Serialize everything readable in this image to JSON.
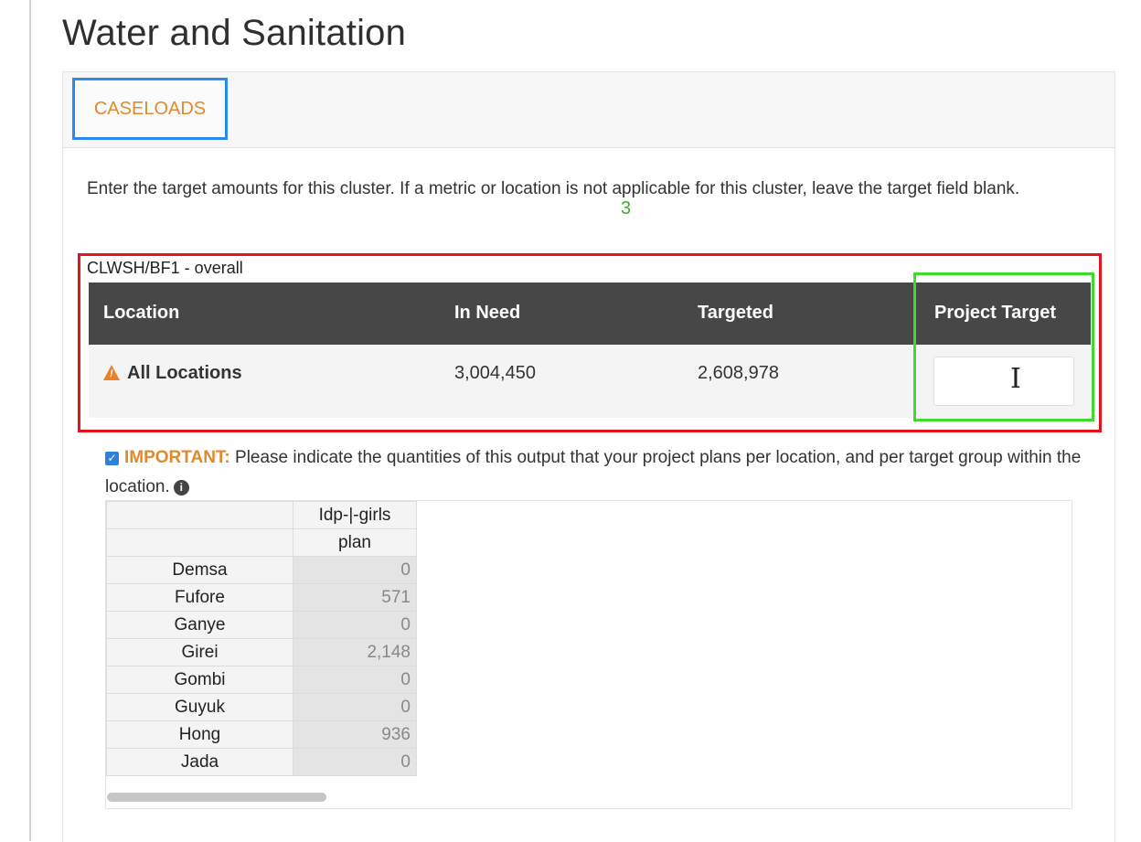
{
  "page": {
    "title": "Water and Sanitation"
  },
  "tabs": [
    {
      "label": "CASELOADS",
      "active": true
    }
  ],
  "instructions": "Enter the target amounts for this cluster. If a metric or location is not applicable for this cluster, leave the target field blank.",
  "annotation_marker": "3",
  "output": {
    "label": "CLWSH/BF1 - overall",
    "columns": [
      "Location",
      "In Need",
      "Targeted",
      "Project Target"
    ],
    "row": {
      "location": "All Locations",
      "in_need": "3,004,450",
      "targeted": "2,608,978",
      "project_target": ""
    }
  },
  "important": {
    "label": "IMPORTANT:",
    "text": " Please indicate the quantities of this output that your project plans per location, and per target group within the location.",
    "checked": true
  },
  "breakdown": {
    "column_group": "Idp-|-girls",
    "column": "plan",
    "rows": [
      {
        "location": "Demsa",
        "plan": "0"
      },
      {
        "location": "Fufore",
        "plan": "571"
      },
      {
        "location": "Ganye",
        "plan": "0"
      },
      {
        "location": "Girei",
        "plan": "2,148"
      },
      {
        "location": "Gombi",
        "plan": "0"
      },
      {
        "location": "Guyuk",
        "plan": "0"
      },
      {
        "location": "Hong",
        "plan": "936"
      },
      {
        "location": "Jada",
        "plan": "0"
      }
    ]
  },
  "colors": {
    "tab_text": "#e08a2e",
    "header_bg": "#474747",
    "highlight_red": "#e3141d",
    "highlight_green": "#3bdc2b",
    "highlight_blue": "#2a8bec"
  }
}
